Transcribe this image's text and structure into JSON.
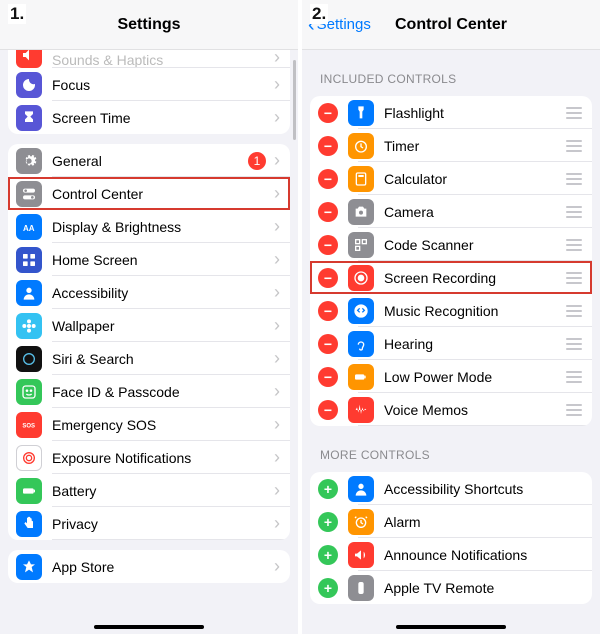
{
  "step1": "1.",
  "step2": "2.",
  "pane1": {
    "title": "Settings",
    "group0": [
      {
        "label": "Sounds & Haptics",
        "bg": "#ff3b30",
        "icon": "speaker"
      },
      {
        "label": "Focus",
        "bg": "#5856d6",
        "icon": "moon"
      },
      {
        "label": "Screen Time",
        "bg": "#5856d6",
        "icon": "hourglass"
      }
    ],
    "group1": [
      {
        "label": "General",
        "bg": "#8e8e93",
        "icon": "gear",
        "badge": "1"
      },
      {
        "label": "Control Center",
        "bg": "#8e8e93",
        "icon": "toggles"
      },
      {
        "label": "Display & Brightness",
        "bg": "#007aff",
        "icon": "display"
      },
      {
        "label": "Home Screen",
        "bg": "#3355cc",
        "icon": "grid"
      },
      {
        "label": "Accessibility",
        "bg": "#007aff",
        "icon": "person"
      },
      {
        "label": "Wallpaper",
        "bg": "#34c2f2",
        "icon": "flower"
      },
      {
        "label": "Siri & Search",
        "bg": "#111",
        "icon": "siri"
      },
      {
        "label": "Face ID & Passcode",
        "bg": "#34c759",
        "icon": "face"
      },
      {
        "label": "Emergency SOS",
        "bg": "#ff3b30",
        "icon": "sos"
      },
      {
        "label": "Exposure Notifications",
        "bg": "#fff",
        "icon": "exposure",
        "fg": "#ff3b30",
        "border": true
      },
      {
        "label": "Battery",
        "bg": "#34c759",
        "icon": "battery"
      },
      {
        "label": "Privacy",
        "bg": "#007aff",
        "icon": "hand"
      }
    ],
    "group2": [
      {
        "label": "App Store",
        "bg": "#007aff",
        "icon": "appstore"
      }
    ]
  },
  "pane2": {
    "back": "Settings",
    "title": "Control Center",
    "section1": "INCLUDED CONTROLS",
    "included": [
      {
        "label": "Flashlight",
        "bg": "#007aff",
        "icon": "flashlight"
      },
      {
        "label": "Timer",
        "bg": "#ff9500",
        "icon": "timer"
      },
      {
        "label": "Calculator",
        "bg": "#ff9500",
        "icon": "calc"
      },
      {
        "label": "Camera",
        "bg": "#8e8e93",
        "icon": "camera"
      },
      {
        "label": "Code Scanner",
        "bg": "#8e8e93",
        "icon": "qr"
      },
      {
        "label": "Screen Recording",
        "bg": "#ff3b30",
        "icon": "record"
      },
      {
        "label": "Music Recognition",
        "bg": "#007aff",
        "icon": "shazam"
      },
      {
        "label": "Hearing",
        "bg": "#007aff",
        "icon": "ear"
      },
      {
        "label": "Low Power Mode",
        "bg": "#ff9500",
        "icon": "lowpower"
      },
      {
        "label": "Voice Memos",
        "bg": "#ff3b30",
        "icon": "voice"
      }
    ],
    "section2": "MORE CONTROLS",
    "more": [
      {
        "label": "Accessibility Shortcuts",
        "bg": "#007aff",
        "icon": "person"
      },
      {
        "label": "Alarm",
        "bg": "#ff9500",
        "icon": "alarm"
      },
      {
        "label": "Announce Notifications",
        "bg": "#ff3b30",
        "icon": "announce"
      },
      {
        "label": "Apple TV Remote",
        "bg": "#8e8e93",
        "icon": "remote"
      }
    ]
  }
}
